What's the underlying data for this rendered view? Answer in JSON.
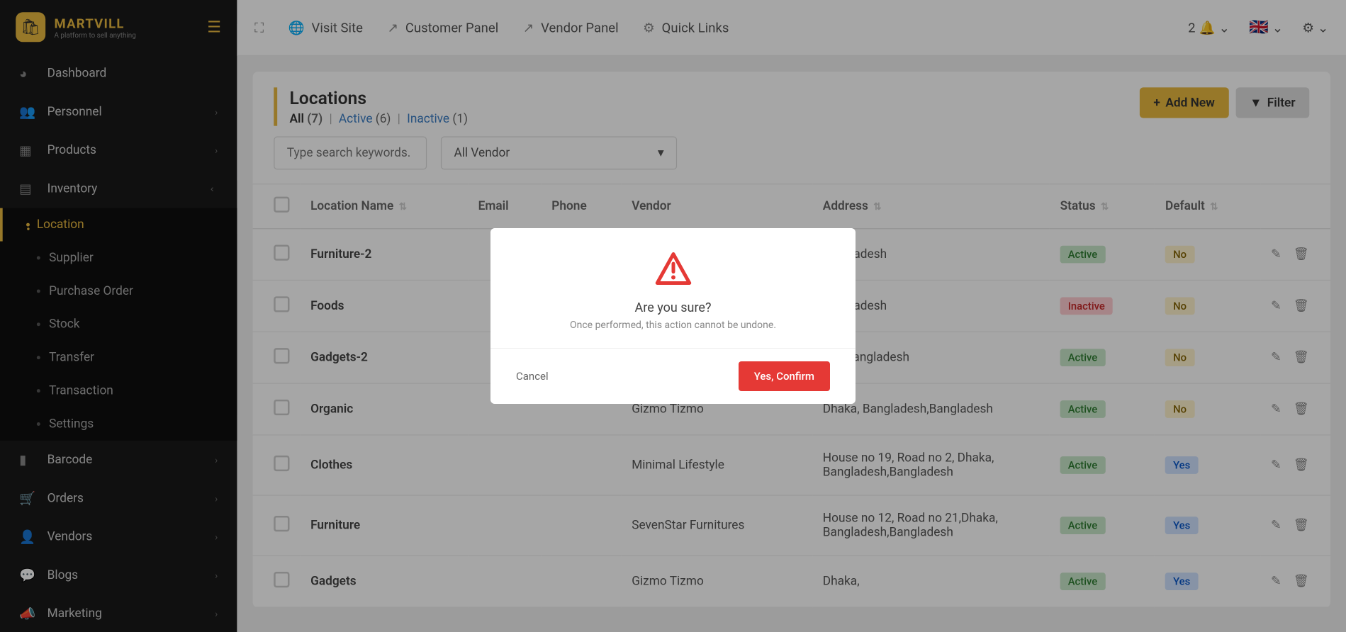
{
  "brand": {
    "name": "MARTVILL",
    "tagline": "A platform to sell anything"
  },
  "sidebar": {
    "items": [
      {
        "label": "Dashboard",
        "expandable": false
      },
      {
        "label": "Personnel",
        "expandable": true
      },
      {
        "label": "Products",
        "expandable": true
      },
      {
        "label": "Inventory",
        "expandable": true,
        "expanded": true
      },
      {
        "label": "Barcode",
        "expandable": true
      },
      {
        "label": "Orders",
        "expandable": true
      },
      {
        "label": "Vendors",
        "expandable": true
      },
      {
        "label": "Blogs",
        "expandable": true
      },
      {
        "label": "Marketing",
        "expandable": true
      }
    ],
    "inventory_sub": [
      {
        "label": "Location",
        "active": true
      },
      {
        "label": "Supplier"
      },
      {
        "label": "Purchase Order"
      },
      {
        "label": "Stock"
      },
      {
        "label": "Transfer"
      },
      {
        "label": "Transaction"
      },
      {
        "label": "Settings"
      }
    ]
  },
  "topbar": {
    "links": [
      "Visit Site",
      "Customer Panel",
      "Vendor Panel",
      "Quick Links"
    ],
    "notif_count": "2"
  },
  "page": {
    "title": "Locations",
    "filters": {
      "all_label": "All",
      "all_count": "(7)",
      "active_label": "Active",
      "active_count": "(6)",
      "inactive_label": "Inactive",
      "inactive_count": "(1)"
    },
    "add_btn": "Add New",
    "filter_btn": "Filter",
    "search_placeholder": "Type search keywords.",
    "vendor_select": "All Vendor"
  },
  "table": {
    "headers": [
      "Location Name",
      "Email",
      "Phone",
      "Vendor",
      "Address",
      "Status",
      "Default"
    ],
    "rows": [
      {
        "name": "Furniture-2",
        "vendor": "",
        "address": "Bangladesh",
        "status": "Active",
        "def": "No"
      },
      {
        "name": "Foods",
        "vendor": "",
        "address": "Bangladesh",
        "status": "Inactive",
        "def": "No"
      },
      {
        "name": "Gadgets-2",
        "vendor": "",
        "address": "our, Bangladesh",
        "status": "Active",
        "def": "No"
      },
      {
        "name": "Organic",
        "vendor": "Gizmo Tizmo",
        "address": "Dhaka, Bangladesh,Bangladesh",
        "status": "Active",
        "def": "No"
      },
      {
        "name": "Clothes",
        "vendor": "Minimal Lifestyle",
        "address": "House no 19, Road no 2, Dhaka, Bangladesh,Bangladesh",
        "status": "Active",
        "def": "Yes"
      },
      {
        "name": "Furniture",
        "vendor": "SevenStar Furnitures",
        "address": "House no 12, Road no 21,Dhaka, Bangladesh,Bangladesh",
        "status": "Active",
        "def": "Yes"
      },
      {
        "name": "Gadgets",
        "vendor": "Gizmo Tizmo",
        "address": "Dhaka,",
        "status": "Active",
        "def": "Yes"
      }
    ]
  },
  "modal": {
    "title": "Are you sure?",
    "text": "Once performed, this action cannot be undone.",
    "cancel": "Cancel",
    "confirm": "Yes, Confirm"
  }
}
